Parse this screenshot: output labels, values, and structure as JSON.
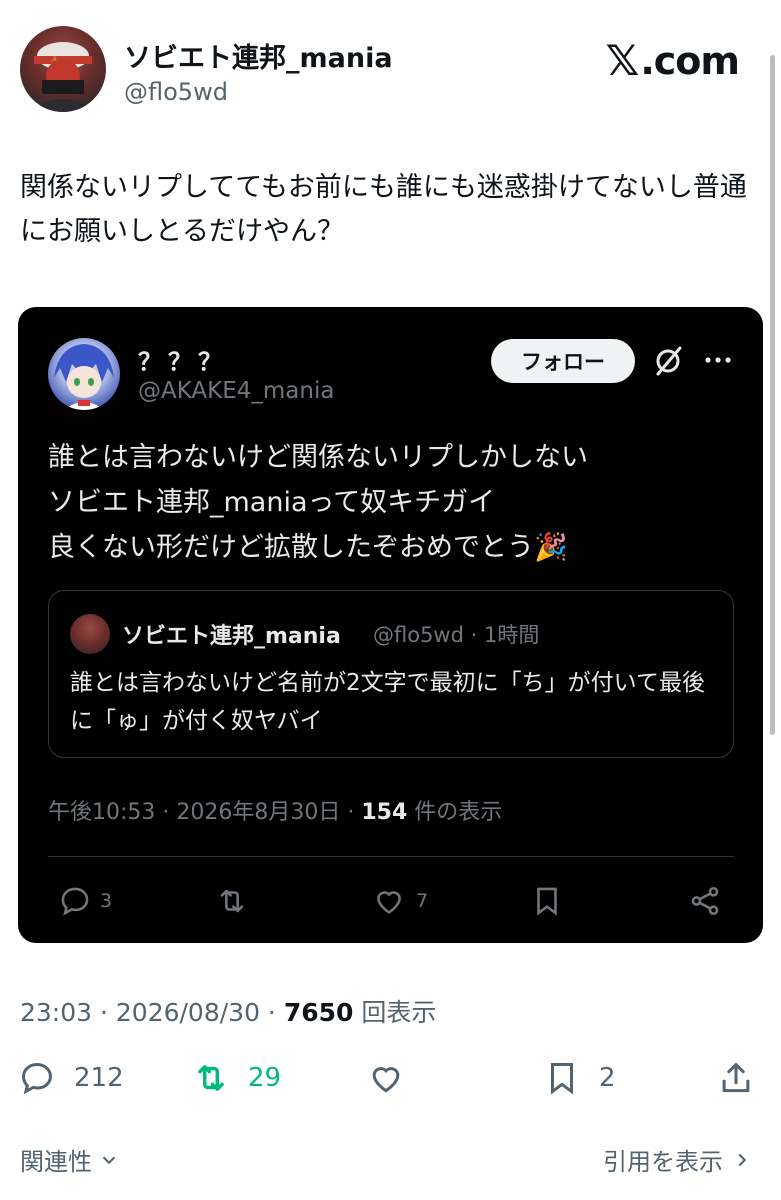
{
  "post": {
    "display_name": "ソビエト連邦_mania",
    "handle": "@flo5wd",
    "brand": ".com",
    "brand_x": "𝕏",
    "text": "関係ないリプしててもお前にも誰にも迷惑掛けてないし普通にお願いしとるだけやん？",
    "timestamp": "23:03 · 2026/08/30 · ",
    "views_count": "7650",
    "views_label": " 回表示",
    "actions": {
      "reply_count": "212",
      "repost_count": "29",
      "bookmark_count": "2"
    },
    "colors": {
      "repost_green": "#00ba7c",
      "muted": "#536471"
    }
  },
  "quoted": {
    "display_name": "？？？",
    "handle": "@AKAKE4_mania",
    "follow_label": "フォロー",
    "text_lines": [
      "誰とは言わないけど関係ないリプしかしない",
      "ソビエト連邦_maniaって奴キチガイ",
      "良くない形だけど拡散したぞおめでとう🎉"
    ],
    "timestamp": "午後10:53 · 2026年8月30日 · ",
    "views_count": "154",
    "views_label": " 件の表示",
    "actions": {
      "reply_count": "3",
      "like_count": "7"
    },
    "nested": {
      "display_name": "ソビエト連邦_mania",
      "meta": "@flo5wd · 1時間",
      "text": "誰とは言わないけど名前が2文字で最初に「ち」が付いて最後に「ゅ」が付く奴ヤバイ"
    }
  },
  "footer": {
    "related_label": "関連性",
    "quotes_label": "引用を表示"
  }
}
